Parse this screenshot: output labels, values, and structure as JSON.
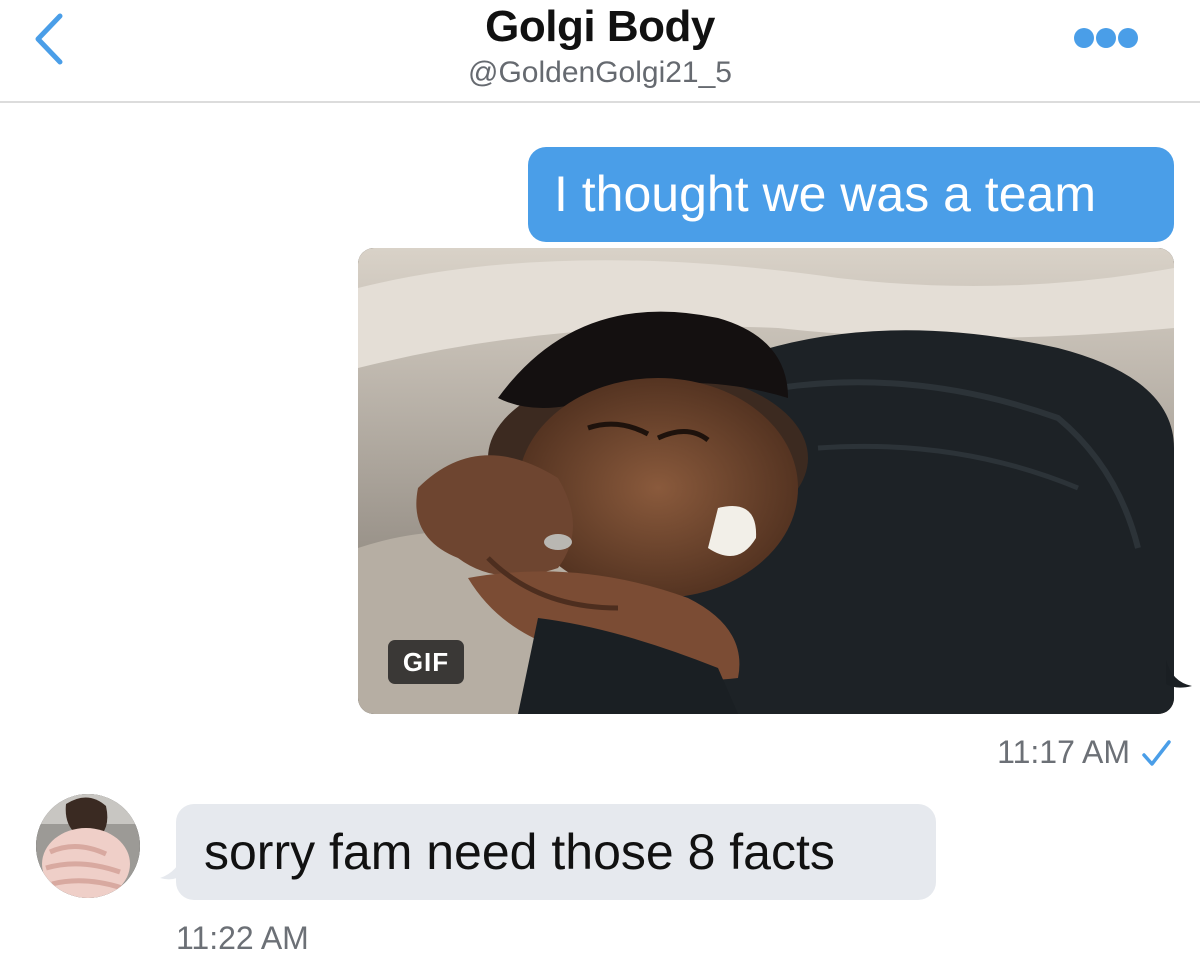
{
  "header": {
    "title": "Golgi Body",
    "handle": "@GoldenGolgi21_5",
    "back_icon": "chevron-left-icon",
    "more_icon": "more-dots-icon"
  },
  "messages": [
    {
      "direction": "outgoing",
      "text": "I thought we was a team"
    },
    {
      "direction": "outgoing",
      "type": "gif",
      "badge": "GIF",
      "time": "11:17 AM",
      "status_icon": "checkmark-icon"
    },
    {
      "direction": "incoming",
      "text": "sorry fam need those 8 facts",
      "time": "11:22 AM"
    }
  ],
  "colors": {
    "accent": "#4a9ee8",
    "outgoing_bubble": "#4a9ee8",
    "incoming_bubble": "#e6e9ee",
    "timestamp": "#6c7076"
  }
}
